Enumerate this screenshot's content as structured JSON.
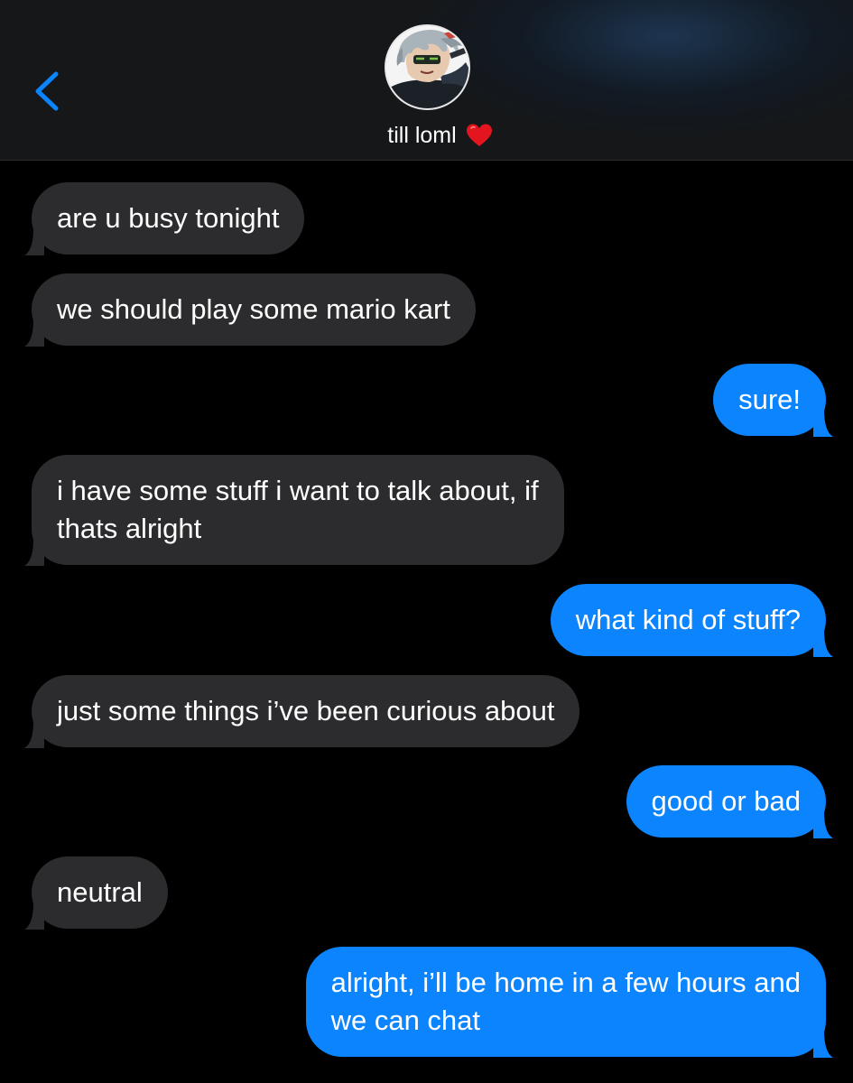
{
  "header": {
    "contact_name": "till loml",
    "back_icon": "chevron-left-icon",
    "heart_icon": "red-heart-emoji",
    "accent_color": "#0b84fe",
    "heart_color": "#e3151f"
  },
  "messages": [
    {
      "direction": "incoming",
      "lines": [
        "are u busy tonight"
      ]
    },
    {
      "direction": "incoming",
      "lines": [
        "we should play some mario kart"
      ]
    },
    {
      "direction": "outgoing",
      "lines": [
        "sure!"
      ]
    },
    {
      "direction": "incoming",
      "lines": [
        "i have some stuff i want to talk about, if",
        "thats alright"
      ]
    },
    {
      "direction": "outgoing",
      "lines": [
        "what kind of stuff?"
      ]
    },
    {
      "direction": "incoming",
      "lines": [
        "just some things i’ve been curious about"
      ]
    },
    {
      "direction": "outgoing",
      "lines": [
        "good or bad"
      ]
    },
    {
      "direction": "incoming",
      "lines": [
        "neutral"
      ]
    },
    {
      "direction": "outgoing",
      "lines": [
        "alright, i’ll be home in a few hours and",
        "we can chat"
      ]
    }
  ],
  "colors": {
    "incoming_bubble": "#2c2c2e",
    "outgoing_bubble": "#0b84fe",
    "background": "#000000"
  }
}
